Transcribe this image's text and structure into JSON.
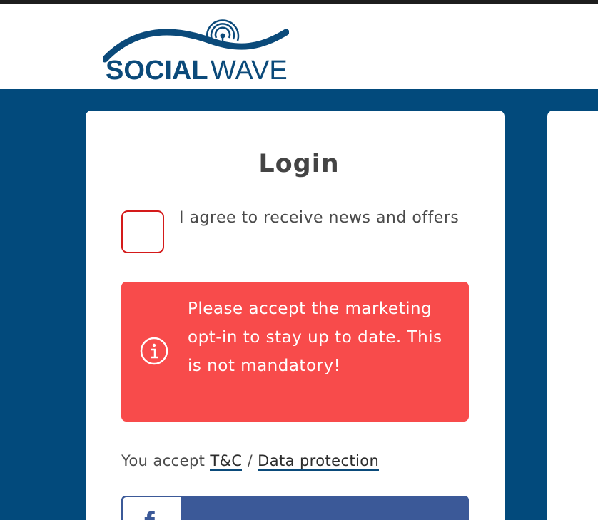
{
  "brand": {
    "name_part1": "SOCIAL",
    "name_part2": "WAVE",
    "primary_color": "#024a7c",
    "accent_color": "#1a5a8a"
  },
  "login": {
    "title": "Login",
    "optin": {
      "label": "I agree to receive news and offers",
      "checked": false
    },
    "alert": {
      "icon": "info-icon",
      "message": "Please accept the marketing opt-in to stay up to date. This is not mandatory!",
      "color": "#f84b4b"
    },
    "legal": {
      "prefix": "You accept",
      "tc_link": "T&C",
      "separator": "/",
      "privacy_link": "Data protection"
    },
    "facebook_button": {
      "icon": "facebook-icon",
      "glyph": "f",
      "color": "#3b5998"
    }
  }
}
